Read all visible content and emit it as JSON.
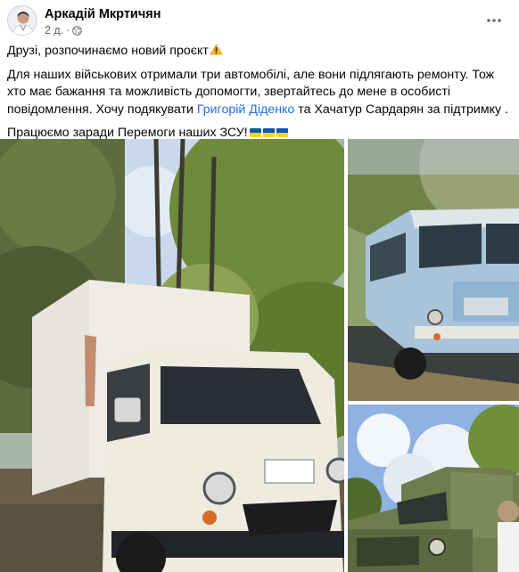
{
  "post": {
    "author": "Аркадій Мкртичян",
    "time": "2 д.",
    "privacy_icon": "globe-icon",
    "menu_icon": "more-options-icon",
    "line1": "Друзі, розпочинаємо новий проєкт",
    "line1_icon": "warning-icon",
    "para2_before_mention": "Для наших військових отримали три автомобілі, але вони підлягають ремонту. Тож хто має бажання та можливість допомогти, звертайтесь до мене в особисті повідомлення. Хочу подякувати ",
    "mention": "Григорій Діденко",
    "para2_after_mention": " та Хачатур Сардарян за підтримку .",
    "line3": "Працюємо заради Перемоги наших ЗСУ!",
    "flag_icon": "ukraine-flag-icon",
    "flag_count": 3
  },
  "photos": [
    {
      "name": "photo-white-box-truck",
      "description_icon": "truck-photo"
    },
    {
      "name": "photo-blue-bus",
      "description_icon": "bus-photo"
    },
    {
      "name": "photo-green-military-truck",
      "description_icon": "truck-photo"
    }
  ],
  "colors": {
    "mention": "#216fdb",
    "secondary_text": "#65676b",
    "flag_blue": "#0057b7",
    "flag_yellow": "#ffd700",
    "warning": "#f7b928"
  }
}
